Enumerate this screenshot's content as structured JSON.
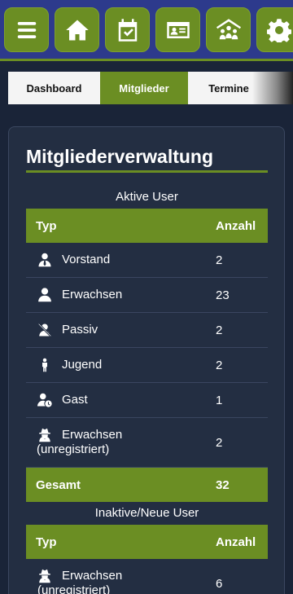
{
  "nav": {
    "buttons": [
      {
        "icon": "menu-icon"
      },
      {
        "icon": "home-icon"
      },
      {
        "icon": "calendar-check-icon"
      },
      {
        "icon": "id-card-icon"
      },
      {
        "icon": "people-roof-icon"
      },
      {
        "icon": "gear-icon"
      }
    ]
  },
  "tabs": [
    {
      "label": "Dashboard"
    },
    {
      "label": "Mitglieder"
    },
    {
      "label": "Termine"
    }
  ],
  "main": {
    "title": "Mitgliederverwaltung",
    "active_table": {
      "caption": "Aktive User",
      "col_type": "Typ",
      "col_count": "Anzahl",
      "rows": [
        {
          "label": "Vorstand",
          "count": "2",
          "icon": "user-tie-icon"
        },
        {
          "label": "Erwachsen",
          "count": "23",
          "icon": "user-icon"
        },
        {
          "label": "Passiv",
          "count": "2",
          "icon": "user-slash-icon"
        },
        {
          "label": "Jugend",
          "count": "2",
          "icon": "child-icon"
        },
        {
          "label": "Gast",
          "count": "1",
          "icon": "user-clock-icon"
        },
        {
          "label": "Erwachsen",
          "label2": "(unregistriert)",
          "count": "2",
          "icon": "user-secret-icon"
        }
      ],
      "total_label": "Gesamt",
      "total_count": "32"
    },
    "inactive_table": {
      "caption": "Inaktive/Neue User",
      "col_type": "Typ",
      "col_count": "Anzahl",
      "rows": [
        {
          "label": "Erwachsen",
          "label2": "(unregistriert)",
          "count": "6",
          "icon": "user-secret-icon"
        }
      ]
    }
  },
  "colors": {
    "accent": "#6b8e23",
    "topbar": "#2d3a8c",
    "background": "#1a2438",
    "card": "#232e42"
  }
}
